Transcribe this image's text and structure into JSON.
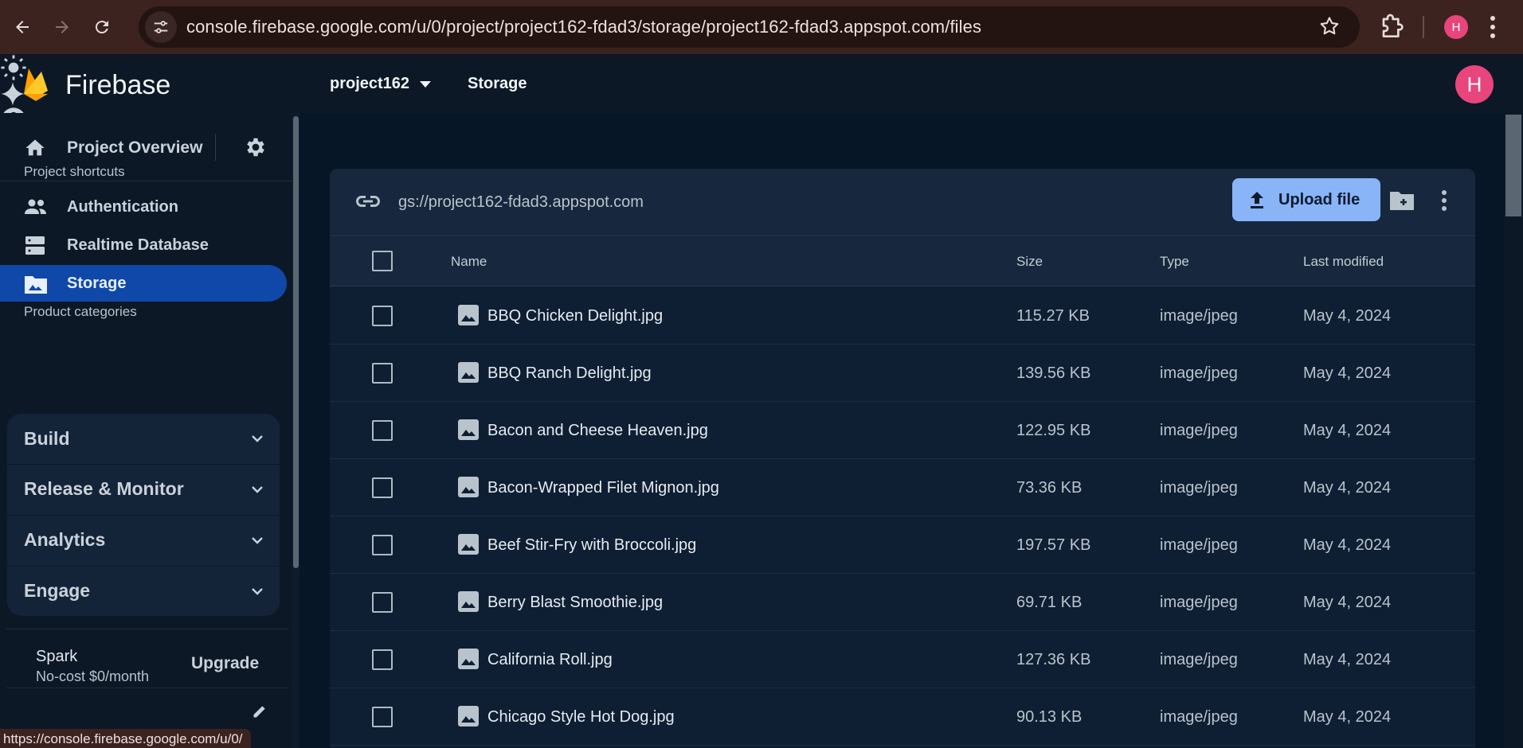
{
  "browser": {
    "url": "console.firebase.google.com/u/0/project/project162-fdad3/storage/project162-fdad3.appspot.com/files",
    "profile_initial": "H",
    "status_url": "https://console.firebase.google.com/u/0/"
  },
  "header": {
    "brand": "Firebase",
    "project": "project162",
    "page": "Storage",
    "avatar_initial": "H",
    "avatar_color": "#e8457c"
  },
  "sidebar": {
    "overview_label": "Project Overview",
    "shortcuts_title": "Project shortcuts",
    "shortcuts": [
      {
        "label": "Authentication",
        "icon": "people-icon"
      },
      {
        "label": "Realtime Database",
        "icon": "database-icon"
      },
      {
        "label": "Storage",
        "icon": "folder-image-icon",
        "active": true
      }
    ],
    "categories_title": "Product categories",
    "categories": [
      {
        "label": "Build"
      },
      {
        "label": "Release & Monitor"
      },
      {
        "label": "Analytics"
      },
      {
        "label": "Engage"
      }
    ],
    "plan": {
      "name": "Spark",
      "price": "No-cost $0/month",
      "upgrade_label": "Upgrade"
    }
  },
  "storage": {
    "bucket": "gs://project162-fdad3.appspot.com",
    "upload_label": "Upload file",
    "columns": {
      "name": "Name",
      "size": "Size",
      "type": "Type",
      "modified": "Last modified"
    },
    "files": [
      {
        "name": "BBQ Chicken Delight.jpg",
        "size": "115.27 KB",
        "type": "image/jpeg",
        "modified": "May 4, 2024"
      },
      {
        "name": "BBQ Ranch Delight.jpg",
        "size": "139.56 KB",
        "type": "image/jpeg",
        "modified": "May 4, 2024"
      },
      {
        "name": "Bacon and Cheese Heaven.jpg",
        "size": "122.95 KB",
        "type": "image/jpeg",
        "modified": "May 4, 2024"
      },
      {
        "name": "Bacon-Wrapped Filet Mignon.jpg",
        "size": "73.36 KB",
        "type": "image/jpeg",
        "modified": "May 4, 2024"
      },
      {
        "name": "Beef Stir-Fry with Broccoli.jpg",
        "size": "197.57 KB",
        "type": "image/jpeg",
        "modified": "May 4, 2024"
      },
      {
        "name": "Berry Blast Smoothie.jpg",
        "size": "69.71 KB",
        "type": "image/jpeg",
        "modified": "May 4, 2024"
      },
      {
        "name": "California Roll.jpg",
        "size": "127.36 KB",
        "type": "image/jpeg",
        "modified": "May 4, 2024"
      },
      {
        "name": "Chicago Style Hot Dog.jpg",
        "size": "90.13 KB",
        "type": "image/jpeg",
        "modified": "May 4, 2024"
      }
    ]
  },
  "colors": {
    "accent": "#8ab4f8",
    "active_nav": "#0f48a8",
    "browser_frame": "#3c2320"
  }
}
